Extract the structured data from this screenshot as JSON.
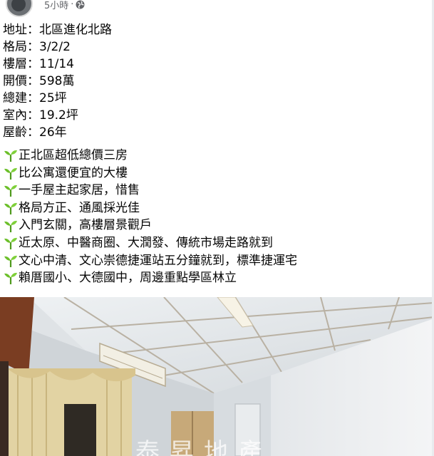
{
  "header": {
    "timestamp": "5小時",
    "separator": "·",
    "privacy_icon": "globe-icon"
  },
  "listing": {
    "details": [
      {
        "text": "地址：北區進化北路"
      },
      {
        "text": "格局：3/2/2"
      },
      {
        "text": "樓層：11/14"
      },
      {
        "text": "開價：598萬"
      },
      {
        "text": "總建：25坪"
      },
      {
        "text": "室內：19.2坪"
      },
      {
        "text": "屋齡：26年"
      }
    ],
    "highlights": [
      {
        "text": "正北區超低總價三房"
      },
      {
        "text": "比公寓還便宜的大樓"
      },
      {
        "text": "一手屋主起家居，惜售"
      },
      {
        "text": "格局方正、通風採光佳"
      },
      {
        "text": "入門玄關，高樓層景觀戶"
      },
      {
        "text": "近太原、中醫商圈、大潤發、傳統市場走路就到"
      },
      {
        "text": "文心中清、文心崇德捷運站五分鐘就到，標準捷運宅"
      },
      {
        "text": "賴厝國小、大德國中，周邊重點學區林立"
      }
    ],
    "bullet_icon": "seedling-icon"
  },
  "photo": {
    "watermark": "泰昇地產"
  },
  "colors": {
    "text": "#050505",
    "meta": "#65676b",
    "sprout_green": "#6cbf2a"
  }
}
